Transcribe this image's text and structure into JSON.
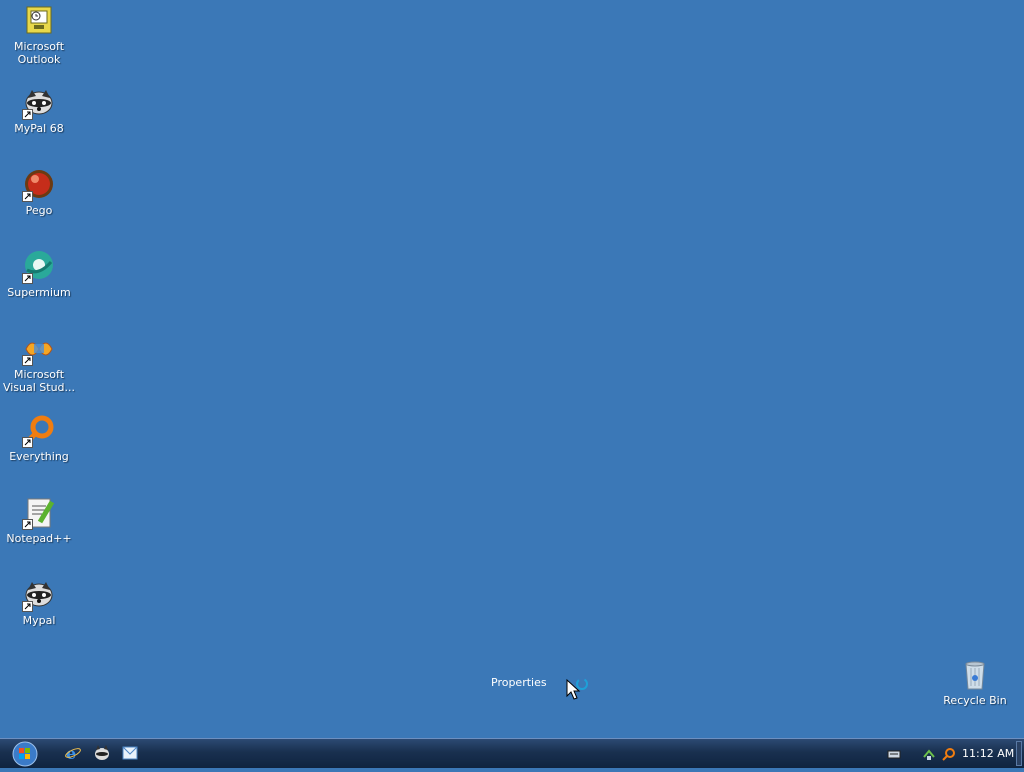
{
  "desktop": {
    "icons": [
      {
        "label": "Microsoft\nOutlook",
        "line1": "Microsoft",
        "line2": "Outlook",
        "icon": "outlook-icon"
      },
      {
        "line1": "MyPal 68",
        "line2": "",
        "icon": "raccoon-icon"
      },
      {
        "line1": "Pego",
        "line2": "",
        "icon": "pego-icon"
      },
      {
        "line1": "Supermium",
        "line2": "",
        "icon": "supermium-icon"
      },
      {
        "line1": "Microsoft",
        "line2": "Visual Stud...",
        "icon": "visual-studio-icon"
      },
      {
        "line1": "Everything",
        "line2": "",
        "icon": "everything-icon"
      },
      {
        "line1": "Notepad++",
        "line2": "",
        "icon": "notepad-plus-plus-icon"
      },
      {
        "line1": "Mypal",
        "line2": "",
        "icon": "raccoon-icon"
      }
    ],
    "recycle_bin": {
      "label": "Recycle Bin",
      "icon": "recycle-bin-icon"
    },
    "floating_text": "Properties"
  },
  "taskbar": {
    "start": "start-orb-icon",
    "quick_launch": [
      "internet-explorer-icon",
      "raccoon-icon",
      "outlook-express-icon"
    ],
    "tray_icons": [
      "keyboard-icon",
      "network-icon",
      "search-icon"
    ],
    "clock": "11:12 AM"
  },
  "colors": {
    "desktop": "#3b78b7",
    "taskbar": "#19304f"
  }
}
